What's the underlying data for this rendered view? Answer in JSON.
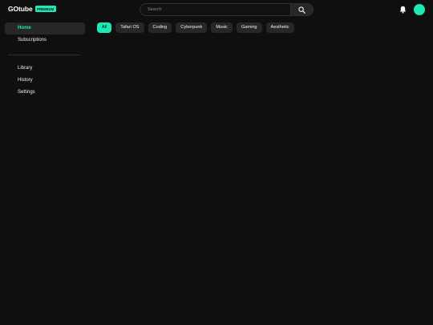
{
  "header": {
    "brand": "GOtube",
    "badge": "PREMIUM",
    "search_placeholder": "Search"
  },
  "colors": {
    "accent": "#1de9b6",
    "background": "#0f0f0f",
    "surface": "#272727"
  },
  "icons": {
    "search": "search-icon",
    "notifications": "bell-icon",
    "account": "avatar"
  },
  "sidebar": {
    "primary": [
      {
        "label": "Home",
        "active": true
      },
      {
        "label": "Subscriptions"
      }
    ],
    "secondary": [
      {
        "label": "Library"
      },
      {
        "label": "History"
      },
      {
        "label": "Settings"
      }
    ]
  },
  "chips": [
    {
      "label": "All",
      "active": true
    },
    {
      "label": "Tafari OS"
    },
    {
      "label": "Coding"
    },
    {
      "label": "Cyberpunk"
    },
    {
      "label": "Music"
    },
    {
      "label": "Gaming"
    },
    {
      "label": "Aesthetic"
    }
  ]
}
